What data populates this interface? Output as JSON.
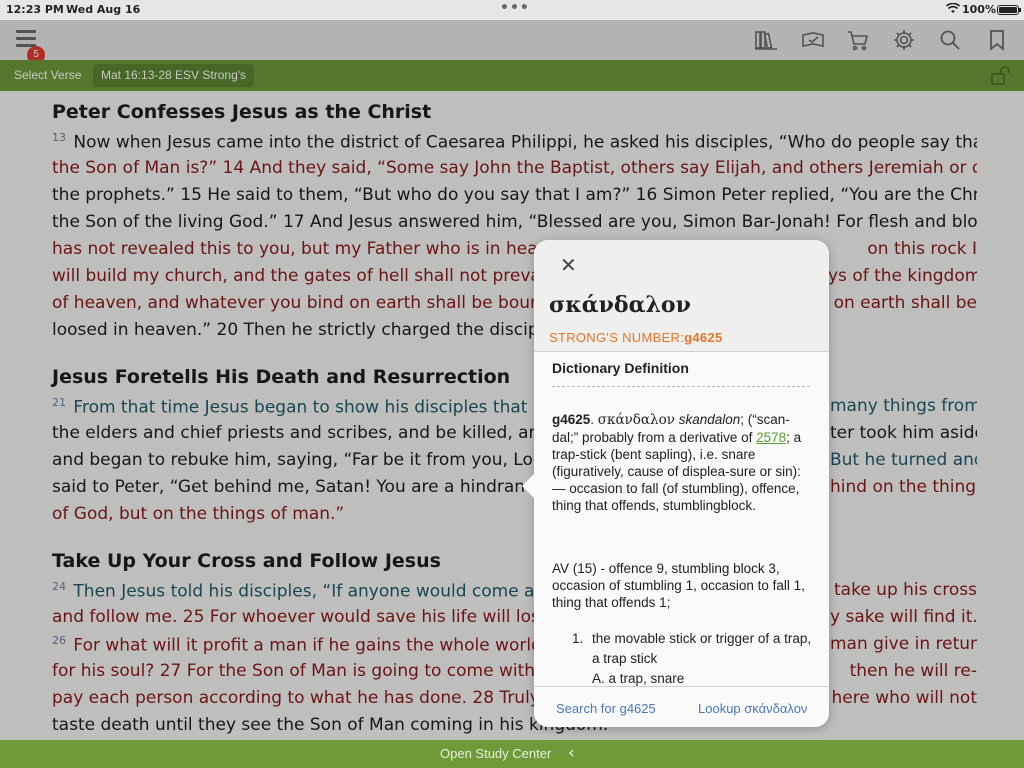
{
  "status": {
    "time": "12:23 PM",
    "date": "Wed Aug 16",
    "battery": "100%"
  },
  "toolbar": {
    "badge": "5"
  },
  "greenbar": {
    "select_label": "Select Verse",
    "reference": "Mat 16:13-28 ESV Strong's"
  },
  "passage": {
    "heading1": "Peter Confesses Jesus as the Christ",
    "heading2": "Jesus Foretells His Death and Resurrection",
    "heading3": "Take Up Your Cross and Follow Jesus",
    "lines": [
      "Now when Jesus came into the district of Caesarea Philippi, he asked his disciples, “Who do people say that",
      "the Son of Man is?” 14 And they said, “Some say John the Baptist, others say Elijah, and others Jeremiah or one of",
      "the prophets.” 15 He said to them, “But who do you say that I am?” 16 Simon Peter replied, “You are the Christ,",
      "the Son of the living God.” 17 And Jesus answered him, “Blessed are you, Simon Bar-Jonah! For flesh and blood",
      "has not revealed this to you, but my Father who is in heav",
      "will build my church, and the gates of hell shall not preva",
      "of heaven, and whatever you bind on earth shall be bound",
      "loosed in heaven.” 20 Then he strictly charged the disciples",
      "From that time Jesus began to show his disciples that",
      "the elders and chief priests and scribes, and be killed, and o",
      "and began to rebuke him, saying, “Far be it from you, Lord!",
      "said to Peter, “Get behind me, Satan! You are a hindrance",
      "of God, but on the things of man.”",
      "Then Jesus told his disciples, “If anyone would come a",
      "and follow me. 25 For whoever would save his life will lose",
      "For what will it profit a man if he gains the whole world a",
      "for his soul? 27 For the Son of Man is going to come with hi",
      "pay each person according to what he has done. 28 Truly, I s",
      "taste death until they see the Son of Man coming in his kingdom."
    ],
    "right_fragments": [
      "on this rock I",
      "ys of the kingdom",
      "on earth shall be",
      "many things from",
      "ter took him aside",
      "But he turned and",
      "hind on the things",
      "take up his cross",
      "y sake will find it.",
      "man give in return",
      "then he will re-",
      "here who will not"
    ]
  },
  "verse_numbers": {
    "v13": "13",
    "v21": "21",
    "v24": "24",
    "v26": "26"
  },
  "popup": {
    "close": "✕",
    "word": "σκάνδαλον",
    "strongs_label": "STRONG'S NUMBER:",
    "strongs_number": "g4625",
    "dict_title": "Dictionary Definition",
    "def_head": "g4625",
    "def_greek": "σκάνδαλον",
    "def_translit": "skandalon",
    "def_part1": "; (“scan-dal;” probably from a derivative of",
    "def_link": "2578",
    "def_part2": "; a trap-stick (bent sapling), i.e. snare (figuratively, cause of displea-sure or sin): — occasion to fall (of stumbling), offence, thing that offends, stumblingblock.",
    "av": "AV (15) - offence 9, stumbling block 3, occasion of stumbling 1, occasion to fall 1, thing that offends 1;",
    "list_num": "1.",
    "list_item": "the movable stick or trigger of a trap, a trap stick",
    "list_sub": "A.  a trap, snare",
    "search_label": "Search for g4625",
    "lookup_label": "Lookup σκάνδαλον"
  },
  "bottombar": {
    "label": "Open Study Center"
  },
  "colors": {
    "green": "#6e9a3a",
    "accent_orange": "#e2762a",
    "link_blue": "#4c78b8",
    "red_letter": "#8a1a1a"
  }
}
